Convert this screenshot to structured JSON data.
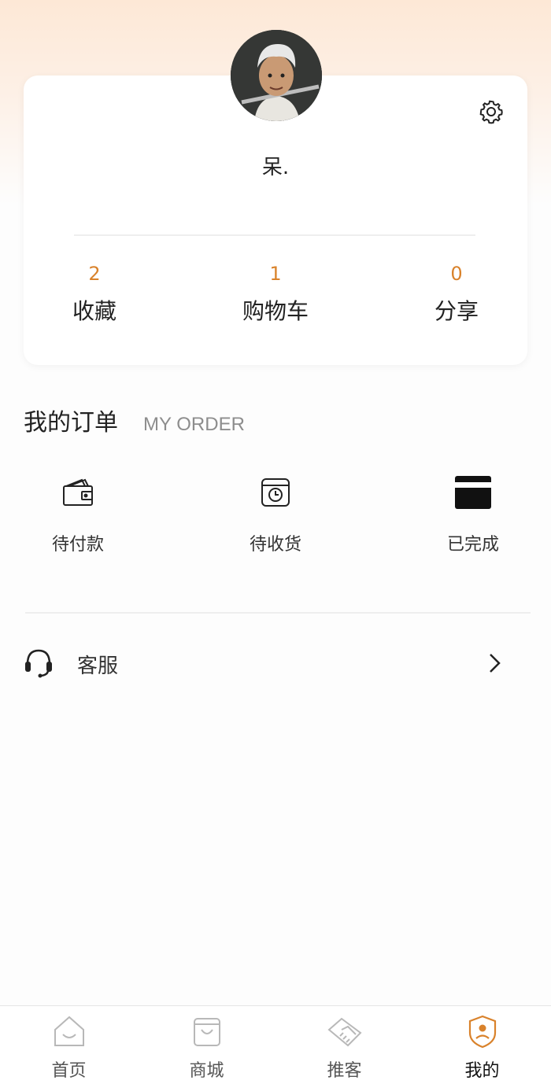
{
  "profile": {
    "username": "呆.",
    "stats": [
      {
        "count": "2",
        "label": "收藏"
      },
      {
        "count": "1",
        "label": "购物车"
      },
      {
        "count": "0",
        "label": "分享"
      }
    ]
  },
  "orders": {
    "title": "我的订单",
    "subtitle": "MY ORDER",
    "items": [
      {
        "label": "待付款",
        "icon": "wallet-icon"
      },
      {
        "label": "待收货",
        "icon": "clock-box-icon"
      },
      {
        "label": "已完成",
        "icon": "card-icon"
      }
    ]
  },
  "service": {
    "label": "客服",
    "icon": "headset-icon"
  },
  "tabbar": {
    "items": [
      {
        "label": "首页",
        "icon": "home-icon"
      },
      {
        "label": "商城",
        "icon": "shopping-bag-icon"
      },
      {
        "label": "推客",
        "icon": "handshake-icon"
      },
      {
        "label": "我的",
        "icon": "user-badge-icon",
        "active": true
      }
    ]
  },
  "colors": {
    "accent": "#d9822b",
    "tab_icon": "#b8b8b8"
  }
}
